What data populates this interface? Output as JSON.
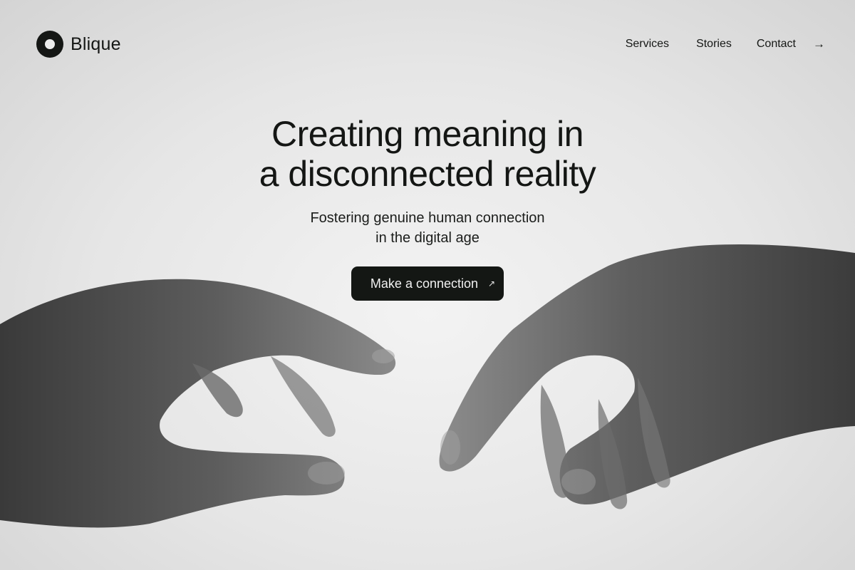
{
  "brand": {
    "name": "Blique",
    "logo_icon": "ring-logo-icon"
  },
  "nav": {
    "links": [
      "Services",
      "Stories",
      "Contact"
    ],
    "arrow": "→",
    "arrow_icon": "arrow-right-icon"
  },
  "hero": {
    "headline_line1": "Creating meaning in",
    "headline_line2": "a disconnected reality",
    "sub_line1": "Fostering genuine human connection",
    "sub_line2": "in the digital age",
    "cta_label": "Make a connection",
    "cta_icon": "↗"
  },
  "colors": {
    "ink": "#141614",
    "background": "#e6e6e6",
    "button": "#141714"
  }
}
